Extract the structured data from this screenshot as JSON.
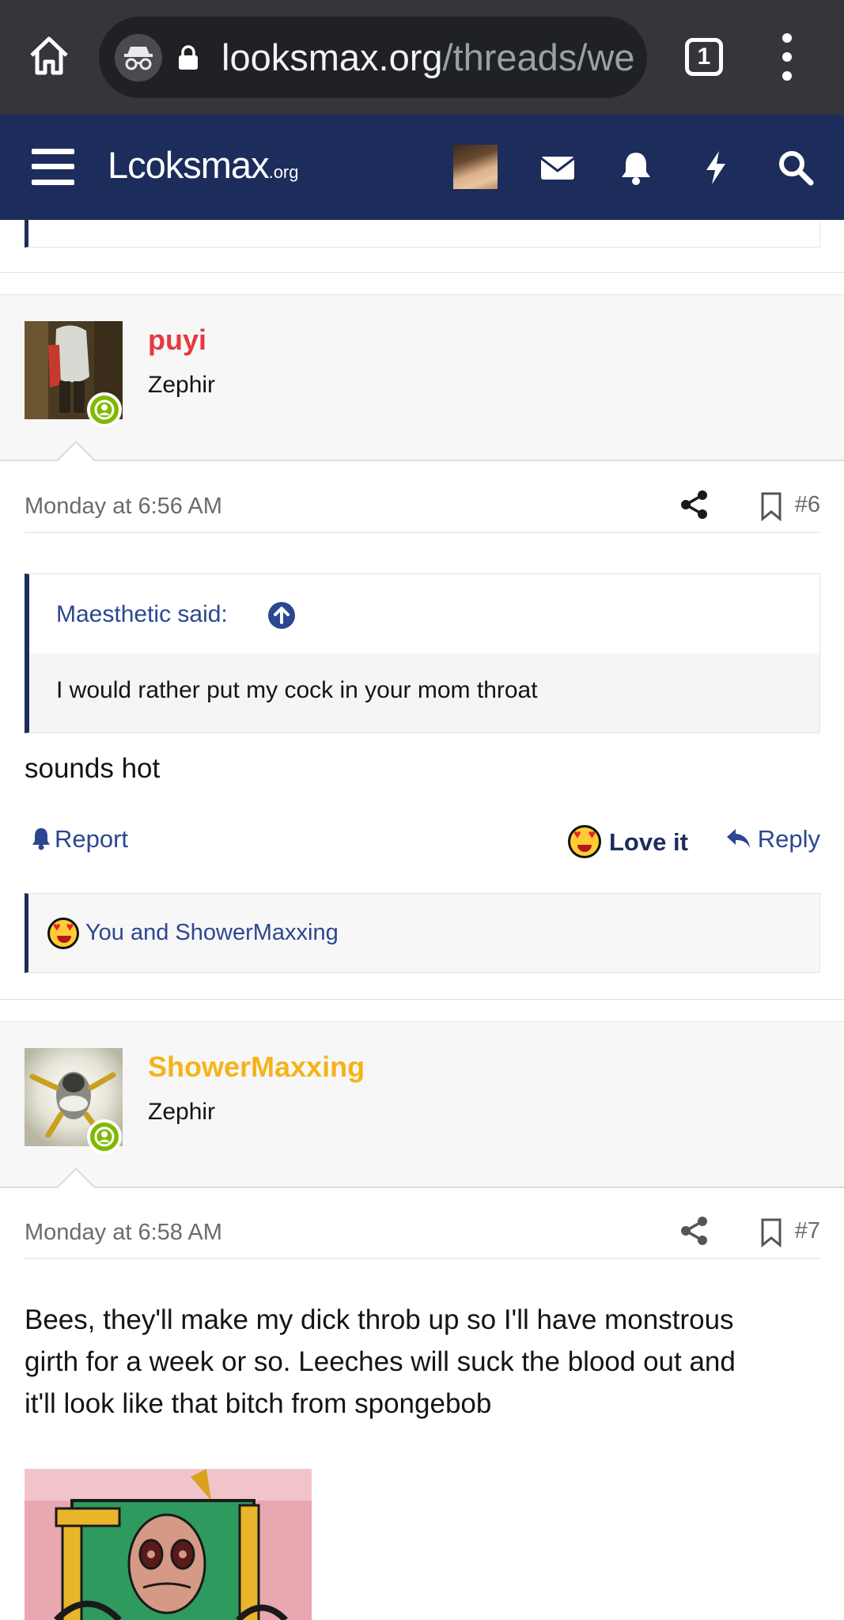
{
  "browser": {
    "url_host": "looksmax.org",
    "url_path": "/threads/wе",
    "tab_count": "1",
    "icons": [
      "home-icon",
      "incognito-icon",
      "lock-icon",
      "menu-dots-icon"
    ]
  },
  "site": {
    "logo_main": "Lcoksmax",
    "logo_suffix": ".org",
    "header_icons": [
      "hamburger-menu-icon",
      "user-avatar",
      "envelope-icon",
      "bell-icon",
      "bolt-icon",
      "search-icon"
    ],
    "colors": {
      "header_bg": "#1c2c5b",
      "link": "#2b4790",
      "online": "#7fb900"
    }
  },
  "posts": [
    {
      "username": "puyi",
      "username_color": "#e8383d",
      "user_title": "Zephir",
      "date": "Monday at 6:56 AM",
      "number": "#6",
      "quote": {
        "author": "Maesthetic said:",
        "text": "I would rather put my cock in your mom throat"
      },
      "body": "sounds hot",
      "actions": {
        "report": "Report",
        "love": "Love it",
        "reply": "Reply"
      },
      "reactions": "You and ShowerMaxxing"
    },
    {
      "username": "ShowerMaxxing",
      "username_color": "#f5b31a",
      "user_title": "Zephir",
      "date": "Monday at 6:58 AM",
      "number": "#7",
      "body_lines": [
        "Bees, they'll make my dick throb up so I'll have monstrous",
        "girth for a week or so. Leeches will suck the blood out and",
        "it'll look like that bitch from spongebob"
      ]
    }
  ]
}
